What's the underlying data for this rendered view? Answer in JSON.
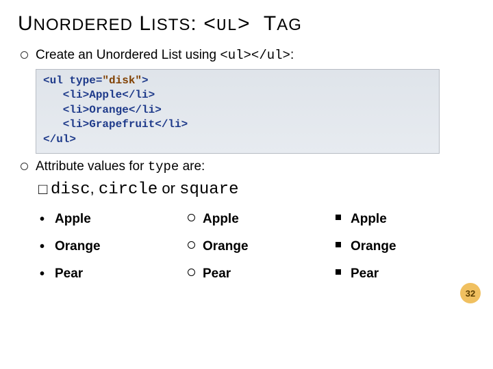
{
  "title": {
    "pre": "U",
    "word1_rest": "NORDERED",
    "word2_pre": "L",
    "word2_rest": "ISTS",
    "colon": ": ",
    "lt": "<",
    "tag_pre": "UL",
    "gt": "> ",
    "word3_pre": "T",
    "word3_rest": "AG"
  },
  "bullets": {
    "b1_pre": "Create an Unordered List using ",
    "b1_code": "<ul></ul>",
    "b1_post": ":",
    "b2_pre": "Attribute values for ",
    "b2_code": "type",
    "b2_post": " are:"
  },
  "code": {
    "l1a": "<ul type=",
    "l1b": "\"disk\"",
    "l1c": ">",
    "l2": "   <li>Apple</li>",
    "l3": "   <li>Orange</li>",
    "l4": "   <li>Grapefruit</li>",
    "l5": "</ul>"
  },
  "types": {
    "lead": "□",
    "t1": "disc",
    "comma1": ", ",
    "t2": "circle",
    "or": " or ",
    "t3": "square"
  },
  "examples": {
    "disc": [
      "Apple",
      "Orange",
      "Pear"
    ],
    "circle": [
      "Apple",
      "Orange",
      "Pear"
    ],
    "square": [
      "Apple",
      "Orange",
      "Pear"
    ]
  },
  "pagenum": "32"
}
